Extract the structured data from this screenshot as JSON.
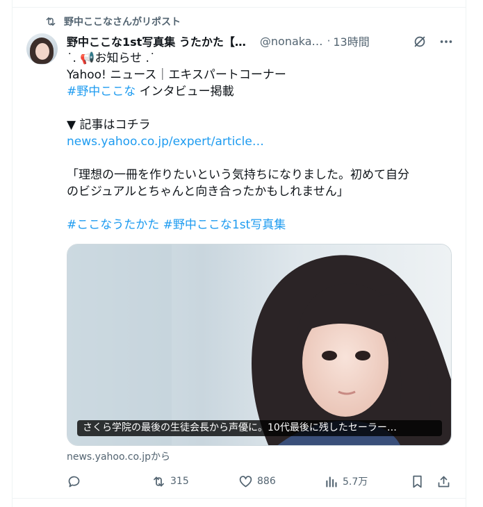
{
  "repost": {
    "label": "野中ここなさんがリポスト"
  },
  "author": {
    "name": "野中ここな1st写真集 うたかた【…",
    "handle": "@nonaka…",
    "separator": "·",
    "time": "13時間"
  },
  "icons": {
    "repost": "repost-icon",
    "grok": "grok-icon",
    "more": "more-icon",
    "reply": "reply-icon",
    "like": "heart-icon",
    "views": "views-icon",
    "bookmark": "bookmark-icon",
    "share": "share-icon"
  },
  "tweet": {
    "line1": "˙. 📢お知らせ .˙",
    "line2": "Yahoo! ニュース｜エキスパートコーナー",
    "line3_tag": "#野中ここな",
    "line3_text": " インタビュー掲載",
    "line4": "▼ 記事はコチラ",
    "link": "news.yahoo.co.jp/expert/article…",
    "quote1": "「理想の一冊を作りたいという気持ちになりました。初めて自分",
    "quote2": "のビジュアルとちゃんと向き合ったかもしれません」",
    "tag1": "#ここなうたかた",
    "tag2": "#野中ここな1st写真集"
  },
  "card": {
    "caption": "さくら学院の最後の生徒会長から声優に。10代最後に残したセーラー…",
    "source": "news.yahoo.co.jpから"
  },
  "stats": {
    "reposts": "315",
    "likes": "886",
    "views": "5.7万"
  },
  "colors": {
    "accent": "#1d9bf0",
    "muted": "#536471",
    "text": "#0f1419",
    "border": "#eff3f4"
  }
}
